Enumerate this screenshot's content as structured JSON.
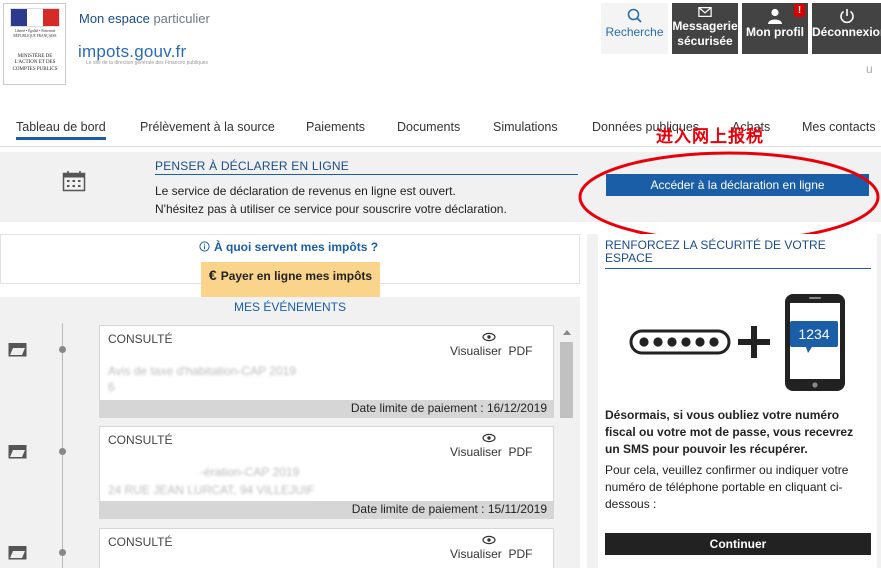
{
  "header": {
    "logo": {
      "motto": "Liberté • Égalité • Fraternité RÉPUBLIQUE FRANÇAISE",
      "ministry": "MINISTÈRE DE L'ACTION ET DES COMPTES PUBLICS"
    },
    "site_title_part1": "Mon espace",
    "site_title_part2": "particulier",
    "brand": "impots.gouv.fr",
    "brand_sub": "Le site de la direction générale des Finances publiques",
    "buttons": {
      "search": "Recherche",
      "messaging_line1": "Messagerie",
      "messaging_line2": "sécurisée",
      "profile": "Mon profil",
      "profile_badge": "!",
      "disconnect": "Déconnexion"
    },
    "ghost_text": "u"
  },
  "nav": {
    "items": [
      "Tableau de bord",
      "Prélèvement à la source",
      "Paiements",
      "Documents",
      "Simulations",
      "Données publiques",
      "Achats",
      "Mes contacts"
    ],
    "active_index": 0
  },
  "annotation": {
    "text": "进入网上报税",
    "color": "#e8000b"
  },
  "declare": {
    "title": "PENSER À DÉCLARER EN LIGNE",
    "line1": "Le service de déclaration de revenus en ligne est ouvert.",
    "line2": "N'hésitez pas à utiliser ce service pour souscrire votre déclaration.",
    "button": "Accéder à la déclaration en ligne"
  },
  "taxes_info": {
    "link": "À quoi servent mes impôts ?",
    "pay_icon": "€",
    "pay_button": "Payer en ligne mes impôts"
  },
  "events": {
    "title": "MES ÉVÉNEMENTS",
    "items": [
      {
        "status": "CONSULTÉ",
        "view": "Visualiser",
        "pdf": "PDF",
        "blur1": "Avis de taxe d'habitation-CAP 2019",
        "blur2": "6",
        "deadline": "Date limite de paiement : 16/12/2019"
      },
      {
        "status": "CONSULTÉ",
        "view": "Visualiser",
        "pdf": "PDF",
        "blur1": "-ération-CAP 2019",
        "blur2": "24 RUE JEAN LURCAT, 94 VILLEJUIF",
        "deadline": "Date limite de paiement : 15/11/2019"
      },
      {
        "status": "CONSULTÉ",
        "view": "Visualiser",
        "pdf": "PDF"
      }
    ]
  },
  "security": {
    "title": "RENFORCEZ LA SÉCURITÉ DE VOTRE ESPACE",
    "phone_code": "1234",
    "bold_text": "Désormais, si vous oubliez votre numéro fiscal ou votre mot de passe, vous recevrez un SMS pour pouvoir les récupérer.",
    "normal_text": "Pour cela, veuillez confirmer ou indiquer votre numéro de téléphone portable en cliquant ci-dessous :",
    "button": "Continuer"
  },
  "colors": {
    "primary_blue": "#1a5ea8",
    "dark_button": "#434343",
    "pay_button": "#f9d48a",
    "annotation_red": "#e8000b"
  }
}
